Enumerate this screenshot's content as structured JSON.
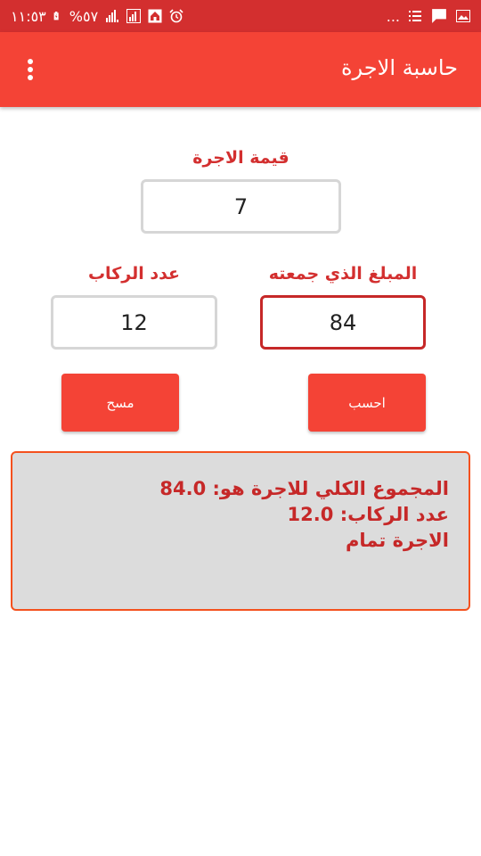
{
  "status_bar": {
    "time": "١١:٥٣",
    "battery": "%٥٧",
    "more": "...",
    "icons": [
      "battery-charging-icon",
      "signal-icon",
      "signal-icon",
      "sim-icon",
      "home-icon",
      "alarm-icon",
      "list-icon",
      "chat-icon",
      "image-icon"
    ]
  },
  "app_bar": {
    "title": "حاسبة الاجرة",
    "menu_icon": "overflow-menu-icon"
  },
  "form": {
    "fare_label": "قيمة الاجرة",
    "fare_value": "7",
    "collected_label": "المبلغ الذي جمعته",
    "collected_value": "84",
    "passengers_label": "عدد الركاب",
    "passengers_value": "12"
  },
  "buttons": {
    "calculate": "احسب",
    "clear": "مسح"
  },
  "result": {
    "total_label": "المجموع الكلي للاجرة هو:",
    "total_value": "84.0",
    "passengers_label": "عدد الركاب:",
    "passengers_value": "12.0",
    "status": "الاجرة تمام"
  },
  "colors": {
    "status_bar": "#d32f2f",
    "app_bar": "#f44336",
    "accent_text": "#d32f2f",
    "result_bg": "#dcdcdc",
    "result_border": "#f4511e"
  }
}
